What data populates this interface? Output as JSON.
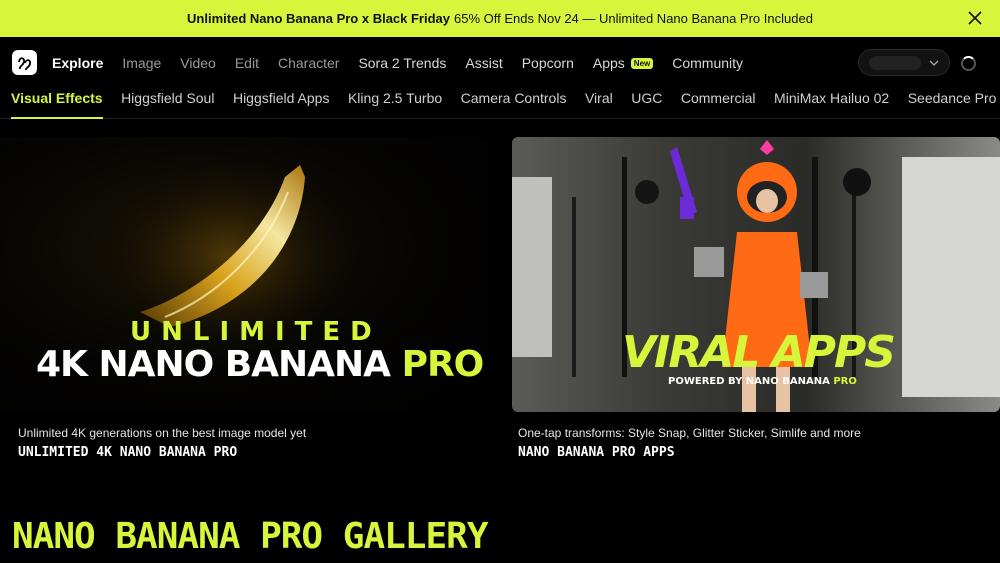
{
  "promo": {
    "headline": "Unlimited Nano Banana Pro x Black Friday",
    "text": "65% Off Ends Nov 24 — Unlimited Nano Banana Pro Included"
  },
  "nav": {
    "items": [
      {
        "label": "Explore"
      },
      {
        "label": "Image"
      },
      {
        "label": "Video"
      },
      {
        "label": "Edit"
      },
      {
        "label": "Character"
      },
      {
        "label": "Sora 2 Trends"
      },
      {
        "label": "Assist"
      },
      {
        "label": "Popcorn"
      },
      {
        "label": "Apps",
        "badge": "New"
      },
      {
        "label": "Community"
      }
    ]
  },
  "subnav": {
    "items": [
      {
        "label": "Visual Effects"
      },
      {
        "label": "Higgsfield Soul"
      },
      {
        "label": "Higgsfield Apps"
      },
      {
        "label": "Kling 2.5 Turbo"
      },
      {
        "label": "Camera Controls"
      },
      {
        "label": "Viral"
      },
      {
        "label": "UGC"
      },
      {
        "label": "Commercial"
      },
      {
        "label": "MiniMax Hailuo 02"
      },
      {
        "label": "Seedance Pro"
      }
    ]
  },
  "cards": [
    {
      "image_line1": "UNLIMITED",
      "image_line2_a": "4K NANO BANANA ",
      "image_line2_b": "PRO",
      "caption": "Unlimited 4K generations on the best image model yet",
      "title": "UNLIMITED 4K NANO BANANA PRO"
    },
    {
      "image_line1": "VIRAL APPS",
      "image_line2_a": "POWERED BY NANO BANANA ",
      "image_line2_b": "PRO",
      "caption": "One-tap transforms: Style Snap, Glitter Sticker, Simlife and more",
      "title": "NANO BANANA PRO APPS"
    }
  ],
  "gallery_heading": "NANO BANANA PRO GALLERY",
  "colors": {
    "accent": "#d7f53a",
    "background": "#000000",
    "suit_orange": "#ff6a14"
  },
  "icons": {
    "logo": "higgsfield-logo-icon",
    "close": "close-icon",
    "dropdown": "chevron-down-icon",
    "loading": "spinner-icon"
  }
}
